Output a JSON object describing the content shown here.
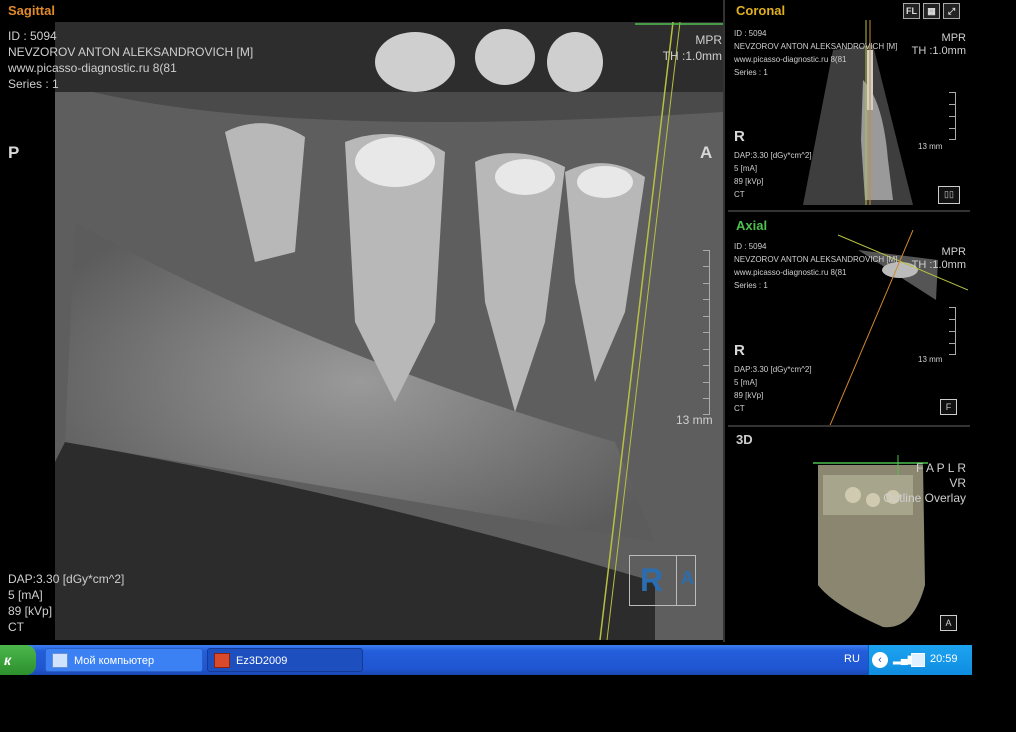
{
  "sagittal": {
    "title": "Sagittal",
    "info": [
      "ID : 5094",
      "NEVZOROV ANTON ALEKSANDROVICH  [M]",
      "www.picasso-diagnostic.ru   8(81",
      "Series : 1"
    ],
    "mpr": "MPR",
    "thickness": "TH :1.0mm",
    "left_orient": "P",
    "right_orient": "A",
    "scale": "13 mm",
    "dose": [
      "DAP:3.30  [dGy*cm^2]",
      "5  [mA]",
      "89 [kVp]",
      "CT"
    ],
    "cube_letter": "R",
    "cube_letter2": "A"
  },
  "coronal": {
    "title": "Coronal",
    "tools": [
      "FL",
      "▦",
      "⤢"
    ],
    "info": [
      "ID : 5094",
      "NEVZOROV ANTON ALEKSANDROVICH [M]",
      "www.picasso-diagnostic.ru   8(81",
      "Series : 1"
    ],
    "mpr": "MPR",
    "thickness": "TH :1.0mm",
    "orient": "R",
    "scale": "13 mm",
    "dose": [
      "DAP:3.30  [dGy*cm^2]",
      "5  [mA]",
      "89 [kVp]",
      "CT"
    ]
  },
  "axial": {
    "title": "Axial",
    "info": [
      "ID : 5094",
      "NEVZOROV ANTON ALEKSANDROVICH [M]",
      "www.picasso-diagnostic.ru   8(81",
      "Series : 1"
    ],
    "mpr": "MPR",
    "thickness": "TH :1.0mm",
    "orient": "R",
    "scale": "13 mm",
    "dose": [
      "DAP:3.30  [dGy*cm^2]",
      "5  [mA]",
      "89 [kVp]",
      "CT"
    ],
    "btn": "F"
  },
  "view3d": {
    "title": "3D",
    "labels": [
      "F A P L R",
      "VR",
      "Outline Overlay"
    ],
    "btn": "A"
  },
  "taskbar": {
    "start": "к",
    "task1": "Мой компьютер",
    "task2": "Ez3D2009",
    "lang": "RU",
    "clock": "20:59"
  },
  "colors": {
    "sagittal": "#e08a2a",
    "coronal": "#e0b020",
    "axial": "#4ec04e",
    "taskbar": "#245edb"
  }
}
